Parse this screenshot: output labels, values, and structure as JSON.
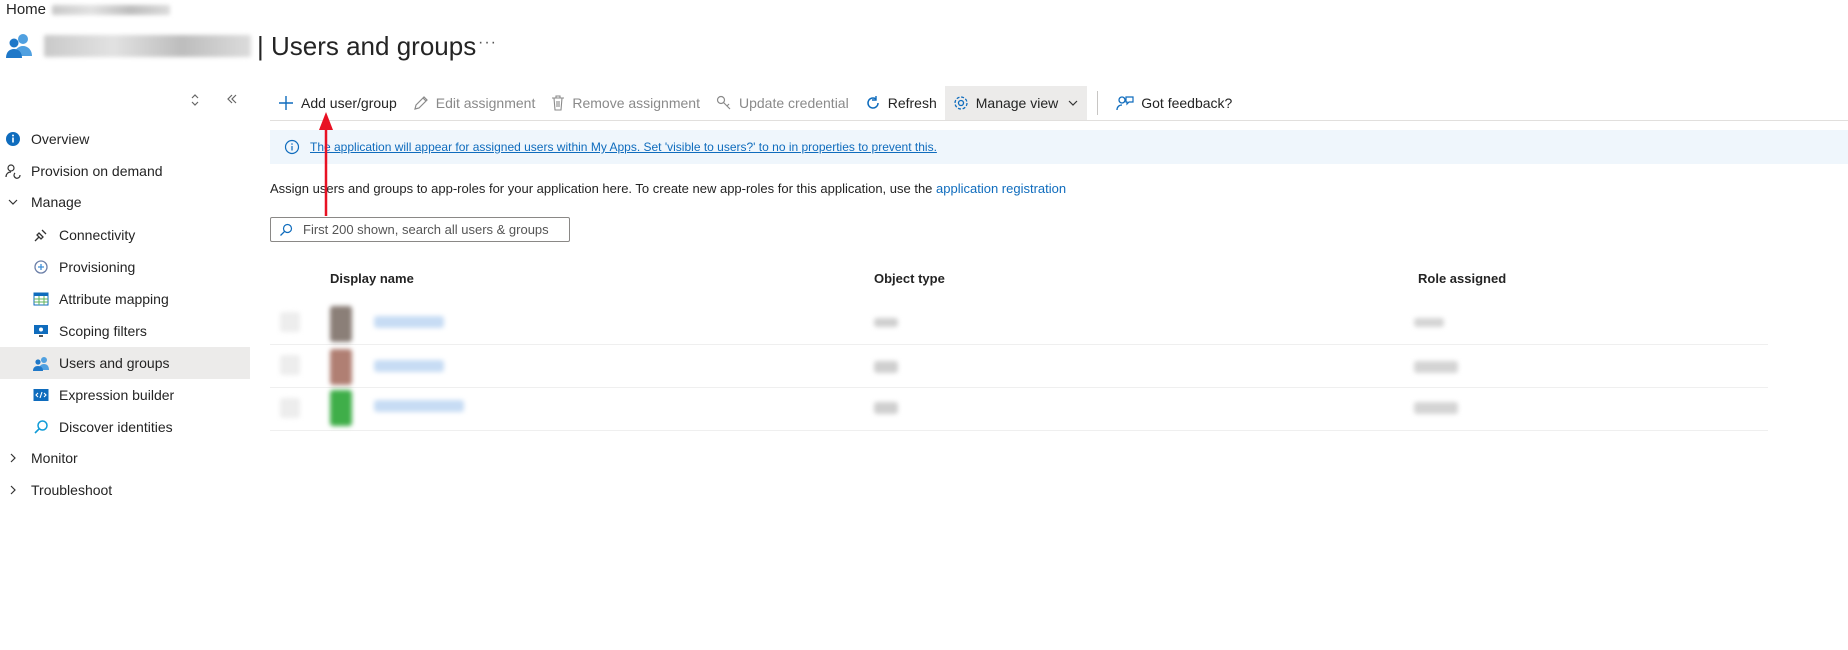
{
  "breadcrumb": {
    "home": "Home"
  },
  "header": {
    "title": "| Users and groups",
    "more": "···"
  },
  "sidebar": {
    "items": [
      {
        "label": "Overview",
        "icon": "info-icon"
      },
      {
        "label": "Provision on demand",
        "icon": "person-sync-icon"
      },
      {
        "label": "Manage",
        "icon": "chevron-down-icon"
      },
      {
        "label": "Connectivity",
        "icon": "plug-icon"
      },
      {
        "label": "Provisioning",
        "icon": "provisioning-icon"
      },
      {
        "label": "Attribute mapping",
        "icon": "table-icon"
      },
      {
        "label": "Scoping filters",
        "icon": "monitor-icon"
      },
      {
        "label": "Users and groups",
        "icon": "people-icon"
      },
      {
        "label": "Expression builder",
        "icon": "code-icon"
      },
      {
        "label": "Discover identities",
        "icon": "search-icon"
      },
      {
        "label": "Monitor",
        "icon": "chevron-right-icon"
      },
      {
        "label": "Troubleshoot",
        "icon": "chevron-right-icon"
      }
    ]
  },
  "toolbar": {
    "add": "Add user/group",
    "edit": "Edit assignment",
    "remove": "Remove assignment",
    "update": "Update credential",
    "refresh": "Refresh",
    "manage_view": "Manage view",
    "feedback": "Got feedback?"
  },
  "banner": {
    "text": "The application will appear for assigned users within My Apps. Set 'visible to users?' to no in properties to prevent this."
  },
  "description": {
    "text": "Assign users and groups to app-roles for your application here. To create new app-roles for this application, use the ",
    "link": "application registration"
  },
  "search": {
    "placeholder": "First 200 shown, search all users & groups"
  },
  "table": {
    "columns": [
      "Display name",
      "Object type",
      "Role assigned"
    ]
  },
  "colors": {
    "accent": "#0f6cbd",
    "annotation_arrow": "#e81123",
    "selected_bg": "#ecebea"
  }
}
